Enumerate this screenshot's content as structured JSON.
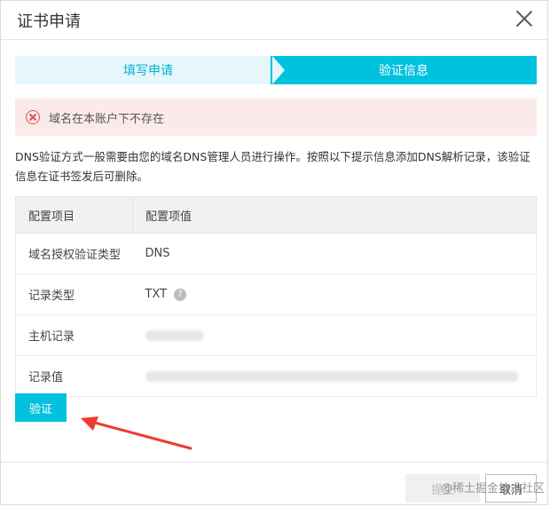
{
  "dialog": {
    "title": "证书申请",
    "close_icon": "close-icon"
  },
  "steps": [
    {
      "label": "填写申请",
      "state": "done"
    },
    {
      "label": "验证信息",
      "state": "active"
    }
  ],
  "alert": {
    "icon": "error-circle-icon",
    "text": "域名在本账户下不存在",
    "color": "#e05252"
  },
  "description": "DNS验证方式一般需要由您的域名DNS管理人员进行操作。按照以下提示信息添加DNS解析记录，该验证信息在证书签发后可删除。",
  "table": {
    "headers": [
      "配置项目",
      "配置项值"
    ],
    "rows": [
      {
        "key": "域名授权验证类型",
        "value": "DNS"
      },
      {
        "key": "记录类型",
        "value": "TXT"
      },
      {
        "key": "主机记录",
        "value": ""
      },
      {
        "key": "记录值",
        "value": ""
      }
    ]
  },
  "buttons": {
    "verify": "验证",
    "submit": "提交",
    "cancel": "取消"
  },
  "watermark": "@稀土掘金技术社区",
  "colors": {
    "accent": "#00c1de",
    "step_done_bg": "#e6f7fb",
    "alert_bg": "#fbeaea"
  }
}
